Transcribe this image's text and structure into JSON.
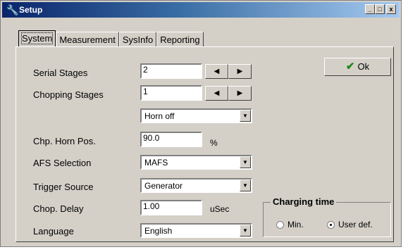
{
  "window": {
    "title": "Setup",
    "controls": [
      "_",
      "□",
      "x"
    ]
  },
  "tabs": [
    "System",
    "Measurement",
    "SysInfo",
    "Reporting"
  ],
  "active_tab": "System",
  "ok_button": "Ok",
  "fields": {
    "serial_stages": {
      "label": "Serial Stages",
      "value": "2"
    },
    "chopping_stages": {
      "label": "Chopping Stages",
      "value": "1"
    },
    "horn": {
      "value": "Horn off"
    },
    "chp_horn_pos": {
      "label": "Chp. Horn Pos.",
      "value": "90.0",
      "unit": "%"
    },
    "afs_selection": {
      "label": "AFS Selection",
      "value": "MAFS"
    },
    "trigger_source": {
      "label": "Trigger  Source",
      "value": "Generator"
    },
    "chop_delay": {
      "label": "Chop. Delay",
      "value": "1.00",
      "unit": "uSec"
    },
    "language": {
      "label": "Language",
      "value": "English"
    }
  },
  "spin_arrows": {
    "left": "◀",
    "right": "▶"
  },
  "dropdown_arrow": "▼",
  "charging_time": {
    "title": "Charging time",
    "options": [
      "Min.",
      "User def."
    ],
    "selected": "User def."
  },
  "icons": {
    "title": "wrench-icon",
    "ok": "checkmark-icon"
  }
}
